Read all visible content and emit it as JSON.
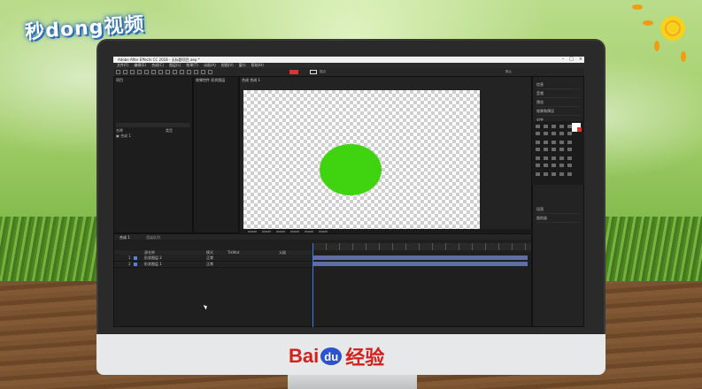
{
  "watermark": {
    "text": "秒dong视频"
  },
  "brand": {
    "bai": "Bai",
    "du": "du",
    "suffix": "经验"
  },
  "app": {
    "title": "Adobe After Effects CC 2018 - 无标题项目.aep *",
    "menu": [
      "文件(F)",
      "编辑(E)",
      "合成(C)",
      "图层(L)",
      "效果(T)",
      "动画(A)",
      "视图(V)",
      "窗口",
      "帮助(H)"
    ],
    "toolbar": {
      "stroke_label": "描边",
      "workspace": "默认"
    },
    "project_tab": "项目",
    "effects_tab": "效果控件 形状图层",
    "project_columns": [
      "名称",
      "类型"
    ],
    "project_item": "合成 1",
    "viewer_tab": "合成 合成 1",
    "right_panels": [
      "信息",
      "音频",
      "预览",
      "效果和预设",
      "对齐",
      "库",
      "字符",
      "段落"
    ],
    "right_bottom": [
      "段落",
      "跟踪器"
    ],
    "timeline": {
      "tab": "合成 1",
      "tab2": "渲染队列",
      "columns": [
        "源名称",
        "模式",
        "TrkMat",
        "父级"
      ],
      "layers": [
        {
          "index": "1",
          "name": "形状图层 2",
          "mode": "正常"
        },
        {
          "index": "2",
          "name": "形状图层 1",
          "mode": "正常"
        }
      ]
    }
  },
  "colors": {
    "shape_fill": "#3fd40f",
    "fill_swatch": "#e0322f"
  }
}
